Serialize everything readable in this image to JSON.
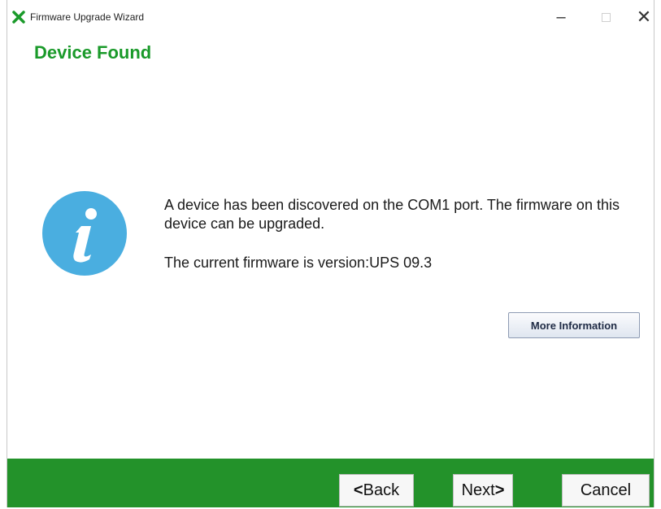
{
  "window": {
    "title": "Firmware Upgrade Wizard",
    "minimize_glyph": "–",
    "close_glyph": "✕"
  },
  "page": {
    "heading": "Device Found",
    "message": "A device has been discovered on the COM1 port. The firmware on this device can be upgraded.",
    "version_text": "The current firmware is version:UPS 09.3",
    "more_info_label": "More Information"
  },
  "footer": {
    "back_arrow": "<",
    "back_label": "Back",
    "next_label": "Next",
    "next_arrow": ">",
    "cancel_label": "Cancel"
  },
  "colors": {
    "accent_green": "#1a9a2a",
    "footer_green": "#23922a",
    "info_blue": "#4aaee0"
  }
}
